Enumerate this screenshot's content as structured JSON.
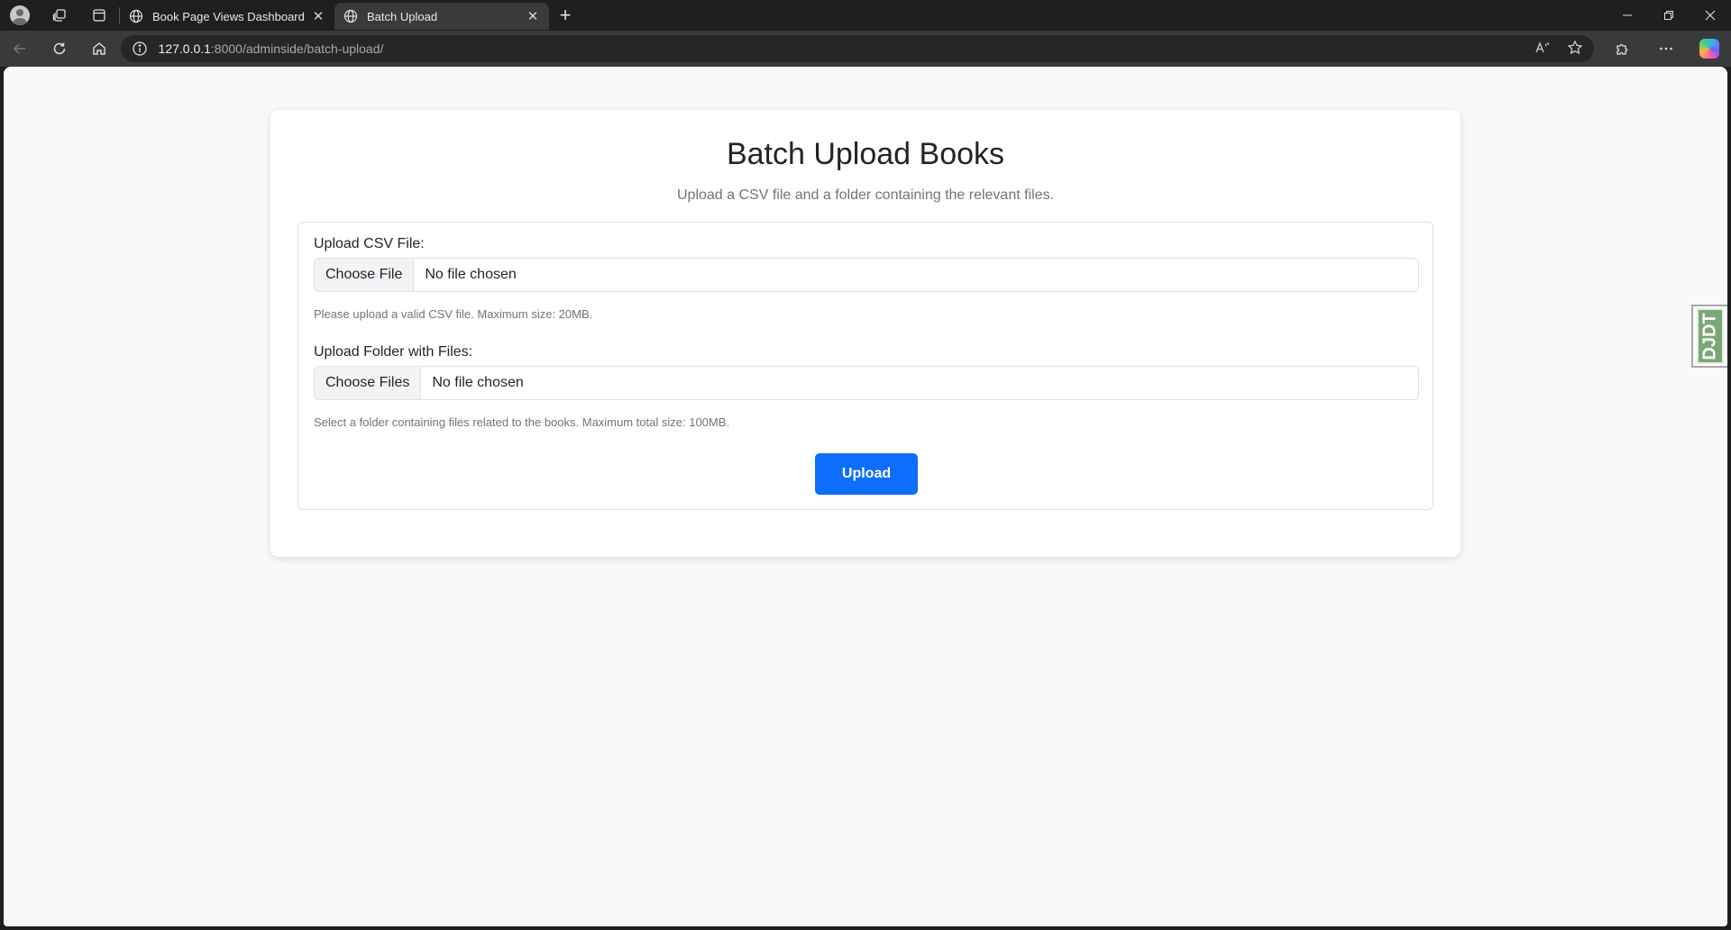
{
  "browser": {
    "tabs": [
      {
        "title": "Book Page Views Dashboard",
        "active": false
      },
      {
        "title": "Batch Upload",
        "active": true
      }
    ],
    "url_host": "127.0.0.1",
    "url_rest": ":8000/adminside/batch-upload/",
    "icons": {
      "profile": "profile-avatar-icon",
      "workspaces": "workspaces-icon",
      "tab_actions": "vertical-tabs-icon",
      "back": "back-arrow-icon",
      "refresh": "refresh-icon",
      "home": "home-icon",
      "info": "site-info-icon",
      "read_aloud": "read-aloud-icon",
      "favorite": "star-icon",
      "extensions": "puzzle-icon",
      "menu": "more-icon",
      "copilot": "copilot-icon"
    }
  },
  "page": {
    "title": "Batch Upload Books",
    "subtitle": "Upload a CSV file and a folder containing the relevant files.",
    "csv": {
      "label": "Upload CSV File:",
      "button": "Choose File",
      "status": "No file chosen",
      "help": "Please upload a valid CSV file. Maximum size: 20MB."
    },
    "folder": {
      "label": "Upload Folder with Files:",
      "button": "Choose Files",
      "status": "No file chosen",
      "help": "Select a folder containing files related to the books. Maximum total size: 100MB."
    },
    "submit_label": "Upload",
    "debug_toolbar_label": "DJDT"
  },
  "colors": {
    "primary": "#0d6efd",
    "page_bg": "#f8f9fa",
    "chrome_bg": "#1f1f1f"
  }
}
